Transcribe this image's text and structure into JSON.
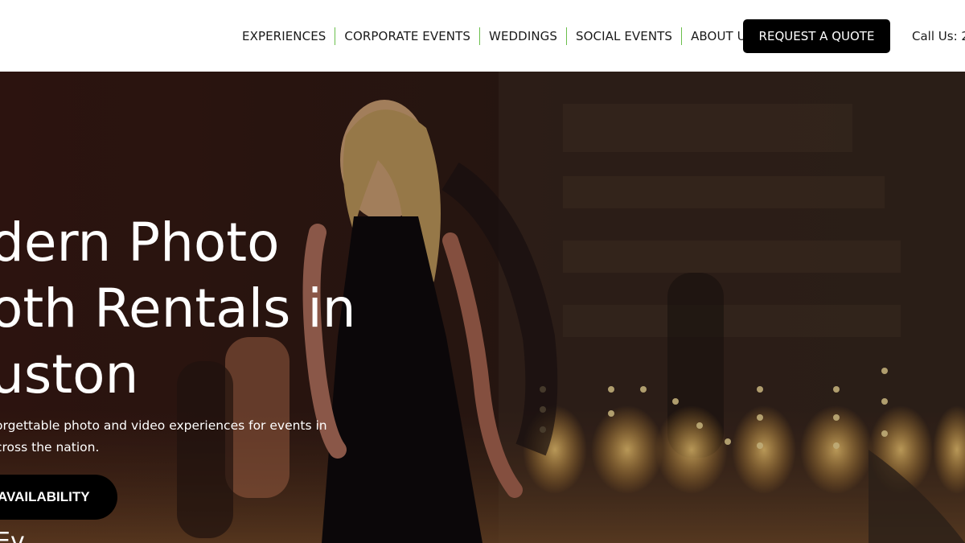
{
  "header": {
    "nav": [
      {
        "label": "EXPERIENCES"
      },
      {
        "label": "CORPORATE EVENTS"
      },
      {
        "label": "WEDDINGS"
      },
      {
        "label": "SOCIAL EVENTS"
      },
      {
        "label": "ABOUT US"
      }
    ],
    "quote_button": "REQUEST A QUOTE",
    "call": "Call Us: 2"
  },
  "hero": {
    "title_lines": [
      "dern Photo",
      "oth Rentals in",
      "uston"
    ],
    "subtitle_lines": [
      "orgettable photo and video experiences for events in",
      "cross the nation."
    ],
    "availability_button": "AVAILABILITY",
    "partial_text": "Ev"
  },
  "colors": {
    "nav_separator": "#6abf4b",
    "button_bg": "#000000",
    "hero_text": "#ffffff"
  }
}
